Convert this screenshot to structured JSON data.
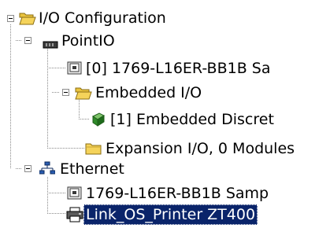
{
  "tree": {
    "root": {
      "label": "I/O Configuration",
      "icon": "folder-open-icon",
      "expanded": true
    },
    "point_io": {
      "label": "PointIO",
      "icon": "backplane-icon",
      "expanded": true
    },
    "point_io_controller": {
      "label": "[0] 1769-L16ER-BB1B Sa",
      "icon": "module-icon"
    },
    "embedded_io": {
      "label": "Embedded I/O",
      "icon": "folder-open-icon",
      "expanded": true
    },
    "embedded_discrete": {
      "label": "[1] Embedded Discret",
      "icon": "io-module-icon"
    },
    "expansion_io": {
      "label": "Expansion I/O, 0 Modules",
      "icon": "folder-icon"
    },
    "ethernet": {
      "label": "Ethernet",
      "icon": "network-icon",
      "expanded": true
    },
    "ethernet_controller": {
      "label": "1769-L16ER-BB1B Samp",
      "icon": "module-icon"
    },
    "printer": {
      "label": "Link_OS_Printer ZT400",
      "icon": "printer-icon",
      "selected": true
    }
  },
  "colors": {
    "selection_bg": "#0a246a",
    "selection_text": "#ffffff",
    "folder_yellow": "#f5d35a",
    "tree_lines": "#8a8a8a"
  }
}
